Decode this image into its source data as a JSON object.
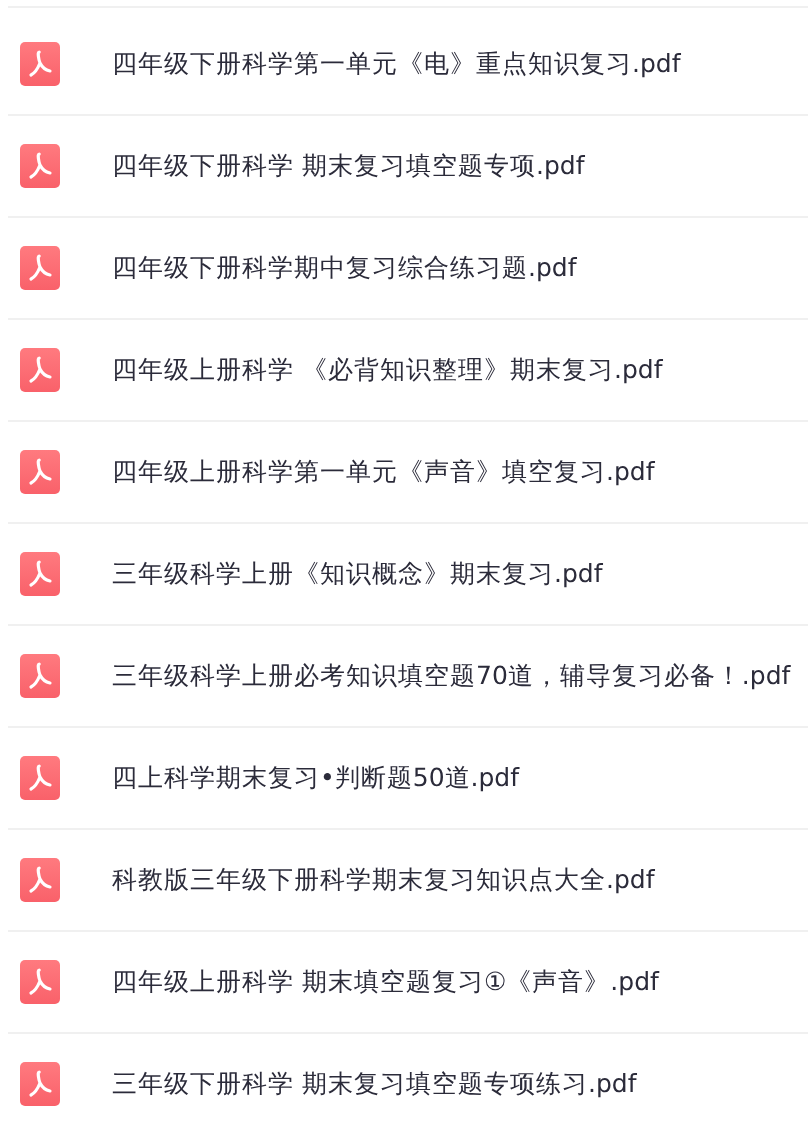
{
  "files": [
    {
      "name": "四年级下册科学第一单元《电》重点知识复习.pdf"
    },
    {
      "name": "四年级下册科学 期末复习填空题专项.pdf"
    },
    {
      "name": "四年级下册科学期中复习综合练习题.pdf"
    },
    {
      "name": "四年级上册科学 《必背知识整理》期末复习.pdf"
    },
    {
      "name": "四年级上册科学第一单元《声音》填空复习.pdf"
    },
    {
      "name": "三年级科学上册《知识概念》期末复习.pdf"
    },
    {
      "name": "三年级科学上册必考知识填空题70道，辅导复习必备！.pdf"
    },
    {
      "name": "四上科学期末复习•判断题50道.pdf"
    },
    {
      "name": "科教版三年级下册科学期末复习知识点大全.pdf"
    },
    {
      "name": "四年级上册科学 期末填空题复习①《声音》.pdf"
    },
    {
      "name": "三年级下册科学 期末复习填空题专项练习.pdf"
    }
  ]
}
